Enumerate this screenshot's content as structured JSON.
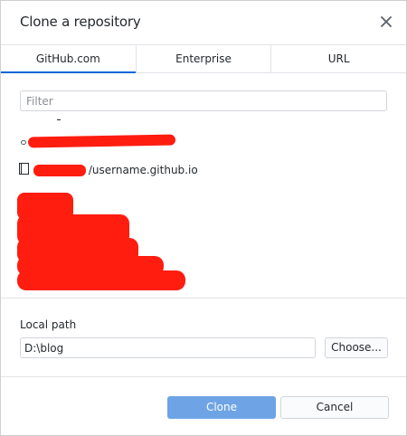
{
  "dialog": {
    "title": "Clone a repository",
    "close_icon": "close-icon"
  },
  "tabs": [
    {
      "label": "GitHub.com",
      "active": true
    },
    {
      "label": "Enterprise",
      "active": false
    },
    {
      "label": "URL",
      "active": false
    }
  ],
  "filter": {
    "placeholder": "Filter",
    "value": ""
  },
  "repositories": [
    {
      "name": "/username.github.io",
      "icon": "repo-icon",
      "owner_redacted": true
    }
  ],
  "local_path": {
    "label": "Local path",
    "value": "D:\\blog",
    "choose_label": "Choose..."
  },
  "actions": {
    "clone_label": "Clone",
    "cancel_label": "Cancel"
  },
  "colors": {
    "accent": "#0366d6",
    "clone_button": "#6ea4e6",
    "redaction": "#ff1d10"
  }
}
